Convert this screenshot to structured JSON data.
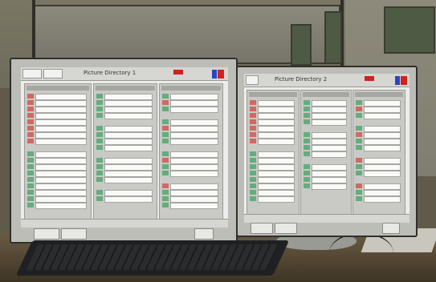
{
  "left_monitor": {
    "window_title": "Picture Directory 1"
  },
  "right_monitor": {
    "window_title": "Picture Directory 2"
  },
  "colors": {
    "screen": "#ececea",
    "bezel": "#bdbdb8",
    "row_green": "#64ad7c",
    "row_red": "#cf6a62",
    "alarm_red": "#d32020",
    "accent_blue": "#2a46c4"
  }
}
